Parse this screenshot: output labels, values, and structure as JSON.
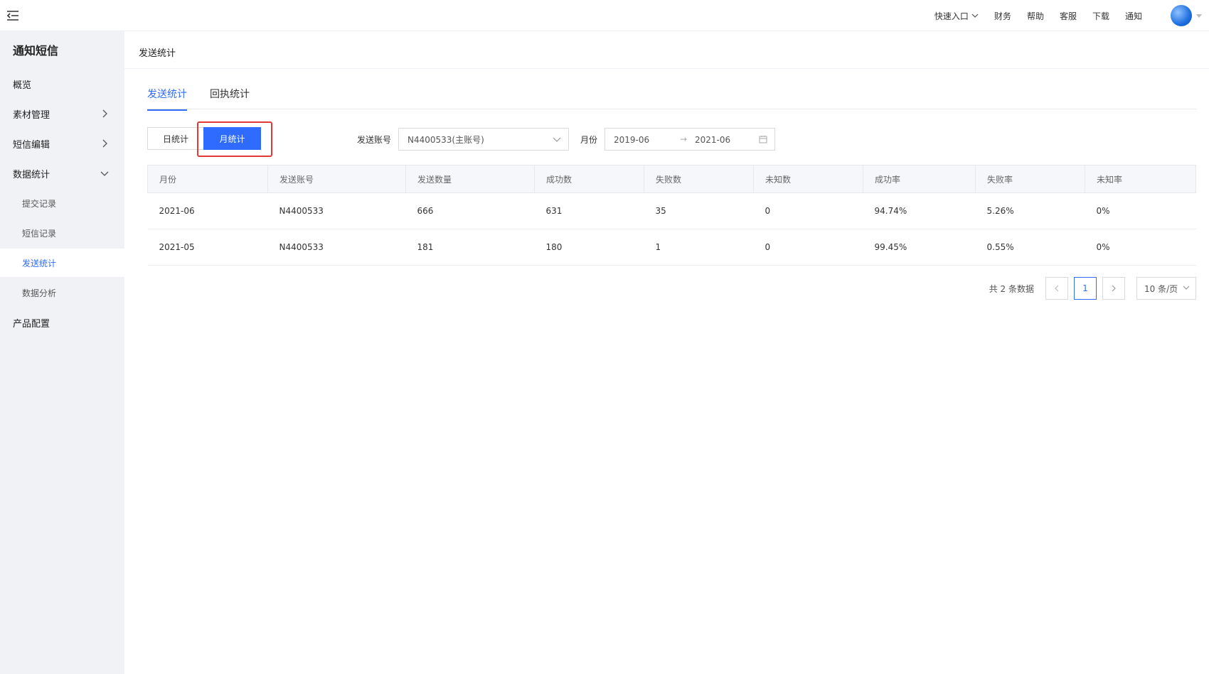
{
  "topbar": {
    "nav": [
      {
        "label": "快速入口",
        "has_dropdown": true
      },
      {
        "label": "财务"
      },
      {
        "label": "帮助"
      },
      {
        "label": "客服"
      },
      {
        "label": "下载"
      },
      {
        "label": "通知"
      }
    ]
  },
  "sidebar": {
    "title": "通知短信",
    "items": [
      {
        "label": "概览"
      },
      {
        "label": "素材管理",
        "arrow": "right"
      },
      {
        "label": "短信编辑",
        "arrow": "right"
      },
      {
        "label": "数据统计",
        "arrow": "down"
      },
      {
        "label": "提交记录"
      },
      {
        "label": "短信记录"
      },
      {
        "label": "发送统计",
        "active": true
      },
      {
        "label": "数据分析"
      },
      {
        "label": "产品配置"
      }
    ]
  },
  "page": {
    "title": "发送统计",
    "tabs": [
      {
        "label": "发送统计",
        "active": true
      },
      {
        "label": "回执统计"
      }
    ]
  },
  "filters": {
    "toggle": {
      "day_label": "日统计",
      "month_label": "月统计",
      "selected": "month"
    },
    "account_label": "发送账号",
    "account_value": "N4400533(主账号)",
    "month_label": "月份",
    "date_start": "2019-06",
    "date_end": "2021-06"
  },
  "table": {
    "columns": [
      "月份",
      "发送账号",
      "发送数量",
      "成功数",
      "失败数",
      "未知数",
      "成功率",
      "失败率",
      "未知率"
    ],
    "rows": [
      [
        "2021-06",
        "N4400533",
        "666",
        "631",
        "35",
        "0",
        "94.74%",
        "5.26%",
        "0%"
      ],
      [
        "2021-05",
        "N4400533",
        "181",
        "180",
        "1",
        "0",
        "99.45%",
        "0.55%",
        "0%"
      ]
    ]
  },
  "pagination": {
    "total_text": "共 2 条数据",
    "current_page": "1",
    "page_size": "10 条/页"
  },
  "colors": {
    "accent": "#2f6bff",
    "highlight": "#e53935",
    "sidebar_bg": "#f0f2f5"
  }
}
